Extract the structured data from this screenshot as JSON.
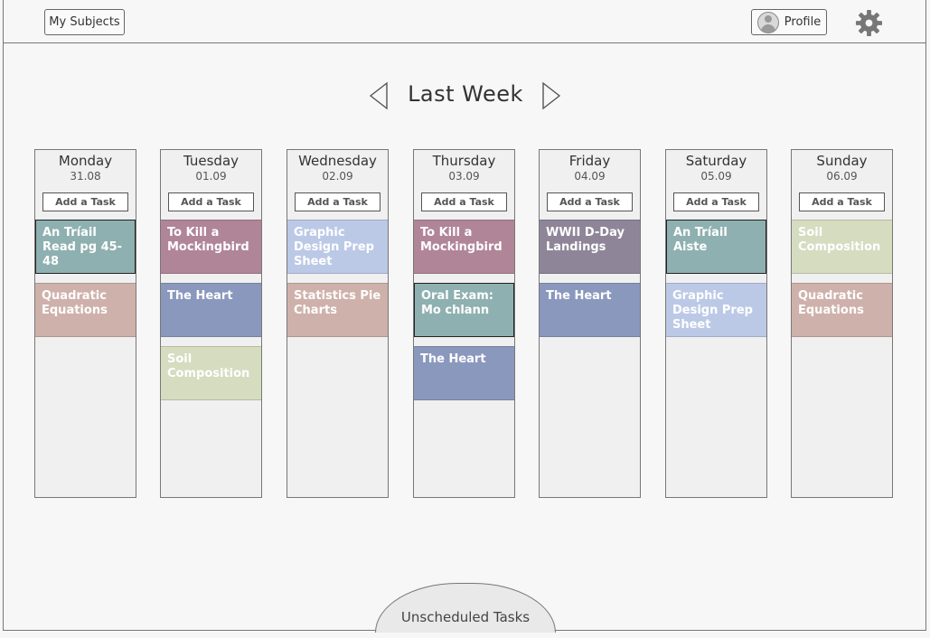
{
  "header": {
    "subjects_label": "My Subjects",
    "profile_label": "Profile"
  },
  "week": {
    "title": "Last Week"
  },
  "add_task_label": "Add a Task",
  "days": [
    {
      "name": "Monday",
      "date": "31.08",
      "tasks": [
        {
          "title": "An Tríail Read pg 45-48"
        },
        {
          "title": "Quadratic Equations"
        }
      ]
    },
    {
      "name": "Tuesday",
      "date": "01.09",
      "tasks": [
        {
          "title": "To Kill a Mockingbird"
        },
        {
          "title": "The Heart"
        },
        {
          "title": "Soil Composition"
        }
      ]
    },
    {
      "name": "Wednesday",
      "date": "02.09",
      "tasks": [
        {
          "title": "Graphic Design Prep Sheet"
        },
        {
          "title": "Statistics Pie Charts"
        }
      ]
    },
    {
      "name": "Thursday",
      "date": "03.09",
      "tasks": [
        {
          "title": "To Kill a Mockingbird"
        },
        {
          "title": "Oral Exam: Mo chlann"
        },
        {
          "title": "The Heart"
        }
      ]
    },
    {
      "name": "Friday",
      "date": "04.09",
      "tasks": [
        {
          "title": "WWII D-Day Landings"
        },
        {
          "title": "The Heart"
        }
      ]
    },
    {
      "name": "Saturday",
      "date": "05.09",
      "tasks": [
        {
          "title": "An Tríail Aiste"
        },
        {
          "title": "Graphic Design Prep Sheet"
        }
      ]
    },
    {
      "name": "Sunday",
      "date": "06.09",
      "tasks": [
        {
          "title": "Soil Composition"
        },
        {
          "title": "Quadratic Equations"
        }
      ]
    }
  ],
  "colors": {
    "teal": "#8fb0b0",
    "rose": "#cfb1ab",
    "mauve": "#b08597",
    "slate": "#8b98bd",
    "sage": "#d5dcc0",
    "sky": "#bcc9e6",
    "grape": "#8e8698"
  },
  "footer": {
    "unscheduled_label": "Unscheduled Tasks"
  }
}
